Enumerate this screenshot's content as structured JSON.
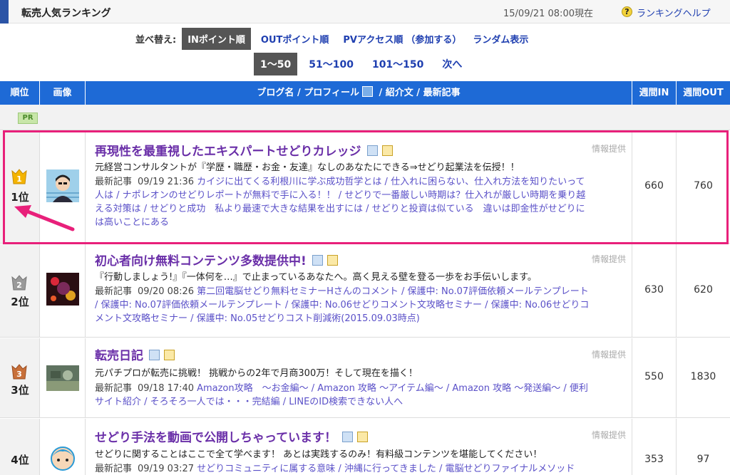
{
  "header": {
    "title": "転売人気ランキング",
    "date": "15/09/21 08:00現在",
    "help_icon": "?",
    "help": "ランキングヘルプ"
  },
  "sort": {
    "label": "並べ替え:",
    "options": [
      "INポイント順",
      "OUTポイント順",
      "PVアクセス順",
      "（参加する）",
      "ランダム表示"
    ]
  },
  "pager": {
    "items": [
      "1〜50",
      "51〜100",
      "101〜150",
      "次へ"
    ]
  },
  "table": {
    "headers": [
      "順位",
      "画像",
      "ブログ名 / プロフィール",
      " / 紹介文 / 最新記事",
      "週間IN",
      "週間OUT"
    ]
  },
  "pr": "PR",
  "rows": [
    {
      "rank": "1位",
      "medal": "1",
      "title": "再現性を最重視したエキスパートせどりカレッジ",
      "info": "情報提供",
      "desc": "元経営コンサルタントが『学歴・職歴・お金・友達』なしのあなたにできる⇒せどり起業法を伝授！！",
      "recent_label": "最新記事",
      "recent_date": "09/19 21:36",
      "recent_lines": [
        "カイジに出てくる利根川に学ぶ成功哲学とは / 仕入れに困らない、仕入れ方法を知りたいって",
        "人は / ナポレオンのせどりレポートが無料で手に入る！！ / せどりで一番厳しい時期は？仕入れが厳しい時期を乗り越",
        "える対策は / せどりと成功　私より最速で大きな結果を出すには / せどりと投資は似ている　違いは即金性がせどりに",
        "は高いことにある"
      ],
      "in": "660",
      "out": "760",
      "medal_color": "#f4b400"
    },
    {
      "rank": "2位",
      "medal": "2",
      "title": "初心者向け無料コンテンツ多数提供中!",
      "info": "情報提供",
      "desc": "『行動しましょう!』『一体何を…』で止まっているあなたへ。高く見える壁を登る一歩をお手伝いします。",
      "recent_label": "最新記事",
      "recent_date": "09/20 08:26",
      "recent_lines": [
        "第二回電脳せどり無料セミナーHさんのコメント / 保護中: No.07評価依頼メールテンプレート",
        "/ 保護中: No.07評価依頼メールテンプレート / 保護中: No.06せどりコメント文攻略セミナー / 保護中: No.06せどりコ",
        "メント文攻略セミナー / 保護中: No.05せどりコスト削減術(2015.09.03時点)"
      ],
      "in": "630",
      "out": "620",
      "medal_color": "#9a9a9a"
    },
    {
      "rank": "3位",
      "medal": "3",
      "title": "転売日記",
      "info": "情報提供",
      "desc": "元パチプロが転売に挑戦！ 挑戦からの2年で月商300万！そして現在を描く！",
      "recent_label": "最新記事",
      "recent_date": "09/18 17:40",
      "recent_lines": [
        "Amazon攻略　～お金編～ / Amazon 攻略 ～アイテム編～ / Amazon 攻略 ～発送編～ / 便利",
        "サイト紹介 / そろそろ一人では・・・完結編 / LINEのID検索できない人へ"
      ],
      "in": "550",
      "out": "1830",
      "medal_color": "#c8703a"
    },
    {
      "rank": "4位",
      "medal": "",
      "title": "せどり手法を動画で公開しちゃっています！",
      "info": "情報提供",
      "desc": "せどりに関することはここで全て学べます！ あとは実践するのみ！有料級コンテンツを堪能してください！",
      "recent_label": "最新記事",
      "recent_date": "09/19 03:27",
      "recent_lines": [
        "せどりコミュニティに属する意味 / 沖縄に行ってきました / 電脳せどりファイナルメソッド"
      ],
      "in": "353",
      "out": "97",
      "medal_color": ""
    }
  ],
  "colors": {
    "accent": "#1e6ad6",
    "highlight": "#e8207a",
    "title": "#6a2fa8",
    "link": "#1f3fb0"
  }
}
